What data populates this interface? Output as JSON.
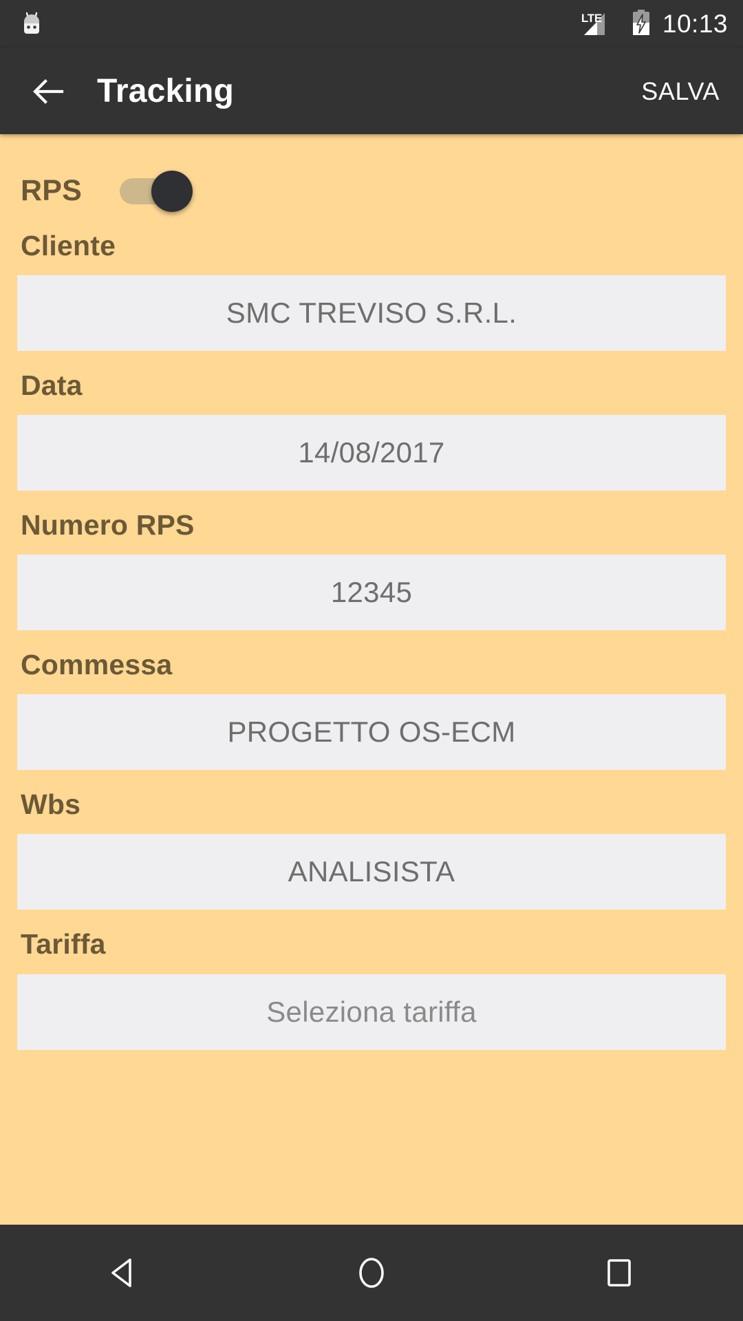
{
  "status_bar": {
    "app_icon": "android-marshmallow-icon",
    "network_type": "LTE",
    "signal_icon": "signal-bars-icon",
    "battery_icon": "battery-charging-icon",
    "time": "10:13"
  },
  "app_bar": {
    "back_icon": "back-arrow-icon",
    "title": "Tracking",
    "save_label": "SALVA"
  },
  "form": {
    "toggle": {
      "label": "RPS",
      "state": "on"
    },
    "fields": [
      {
        "label": "Cliente",
        "value": "SMC TREVISO S.R.L.",
        "is_placeholder": false
      },
      {
        "label": "Data",
        "value": "14/08/2017",
        "is_placeholder": false
      },
      {
        "label": "Numero RPS",
        "value": "12345",
        "is_placeholder": false
      },
      {
        "label": "Commessa",
        "value": "PROGETTO OS-ECM",
        "is_placeholder": false
      },
      {
        "label": "Wbs",
        "value": "ANALISISTA",
        "is_placeholder": false
      },
      {
        "label": "Tariffa",
        "value": "Seleziona tariffa",
        "is_placeholder": true
      }
    ]
  },
  "nav_bar": {
    "back_icon": "nav-back-triangle-icon",
    "home_icon": "nav-home-circle-icon",
    "recents_icon": "nav-recents-square-icon"
  },
  "colors": {
    "background": "#FFD894",
    "app_bar": "#333333",
    "label_text": "#6B5937",
    "field_background": "#EFEFF1",
    "field_text": "#6E6E6E",
    "toggle_track": "#CCB88A",
    "toggle_thumb": "#2F3034"
  }
}
